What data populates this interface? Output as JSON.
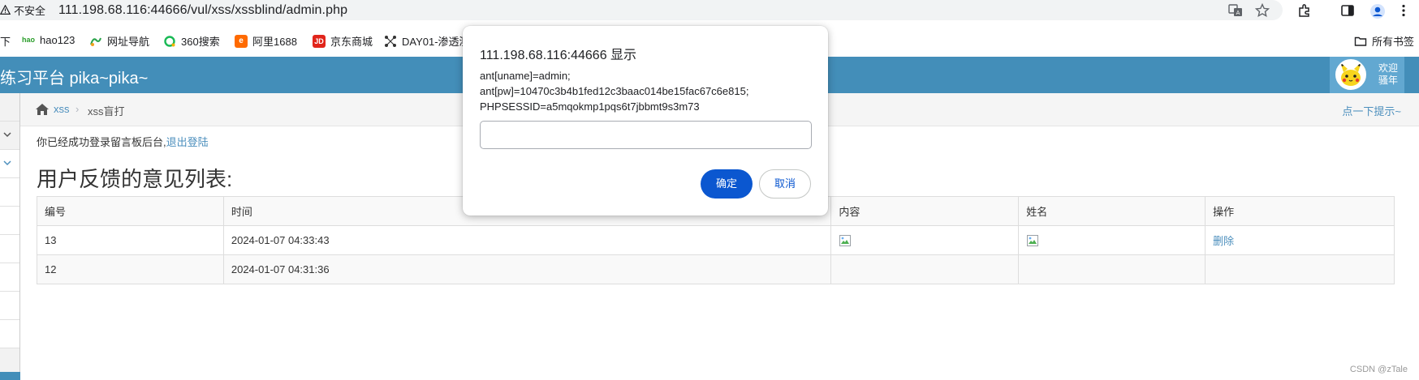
{
  "browser": {
    "insecure_label": "不安全",
    "url": "111.198.68.116:44666/vul/xss/xssblind/admin.php",
    "bookmarks": [
      {
        "label": "下",
        "icon": "bookmark-icon"
      },
      {
        "label": "hao123",
        "icon": "hao123-icon"
      },
      {
        "label": "网址导航",
        "icon": "nav-icon"
      },
      {
        "label": "360搜索",
        "icon": "360-search-icon"
      },
      {
        "label": "阿里1688",
        "icon": "ali1688-icon"
      },
      {
        "label": "京东商城",
        "icon": "jd-icon"
      },
      {
        "label": "DAY01-渗透测",
        "icon": "graph-icon"
      }
    ],
    "all_bookmarks_label": "所有书签"
  },
  "site": {
    "brand": "练习平台 pika~pika~",
    "welcome_line1": "欢迎",
    "welcome_line2": "骚年"
  },
  "breadcrumb": {
    "link": "xss",
    "separator": "›",
    "current": "xss盲打",
    "hint": "点一下提示~"
  },
  "main": {
    "login_message": "你已经成功登录留言板后台,",
    "logout_link": "退出登陆",
    "list_title": "用户反馈的意见列表:",
    "table": {
      "headers": [
        "编号",
        "时间",
        "内容",
        "姓名",
        "操作"
      ],
      "rows": [
        {
          "id": "13",
          "time": "2024-01-07 04:33:43",
          "content_img": true,
          "name_img": true,
          "action": "删除"
        },
        {
          "id": "12",
          "time": "2024-01-07 04:31:36",
          "content_img": false,
          "name_img": false,
          "action": ""
        }
      ]
    }
  },
  "dialog": {
    "title": "111.198.68.116:44666 显示",
    "message_lines": [
      "ant[uname]=admin;",
      "ant[pw]=10470c3b4b1fed12c3baac014be15fac67c6e815;",
      "PHPSESSID=a5mqokmp1pqs6t7jbbmt9s3m73"
    ],
    "input_value": "",
    "ok_label": "确定",
    "cancel_label": "取消"
  },
  "watermark": "CSDN @zTale",
  "colors": {
    "header_blue": "#438eb9",
    "link_blue": "#4c8fbd",
    "primary_button": "#0b57d0"
  }
}
